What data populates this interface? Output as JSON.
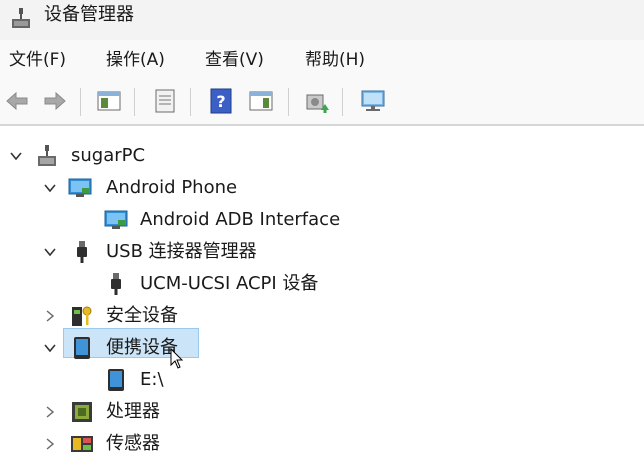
{
  "window": {
    "title": "设备管理器"
  },
  "menu": [
    {
      "label": "文件(F)"
    },
    {
      "label": "操作(A)"
    },
    {
      "label": "查看(V)"
    },
    {
      "label": "帮助(H)"
    }
  ],
  "toolbar": {
    "buttons": [
      "back-arrow-icon",
      "forward-arrow-icon",
      "show-hide-console-tree-icon",
      "properties-icon",
      "help-icon",
      "action-pane-icon",
      "update-driver-icon",
      "scan-hardware-icon"
    ]
  },
  "tree": {
    "root": {
      "label": "sugarPC",
      "expanded": true
    },
    "nodes": [
      {
        "label": "Android Phone",
        "expanded": true
      },
      {
        "label": "Android ADB Interface"
      },
      {
        "label": "USB 连接器管理器",
        "expanded": true
      },
      {
        "label": "UCM-UCSI ACPI 设备"
      },
      {
        "label": "安全设备",
        "expanded": false
      },
      {
        "label": "便携设备",
        "expanded": true,
        "selected": true
      },
      {
        "label": "E:\\"
      },
      {
        "label": "处理器",
        "expanded": false
      },
      {
        "label": "传感器",
        "expanded": false
      }
    ]
  },
  "colors": {
    "selection": "#cce4f7",
    "selection_border": "#99c9ef",
    "menubar": "#f9f9f9",
    "titlebar": "#f3f3f3"
  }
}
